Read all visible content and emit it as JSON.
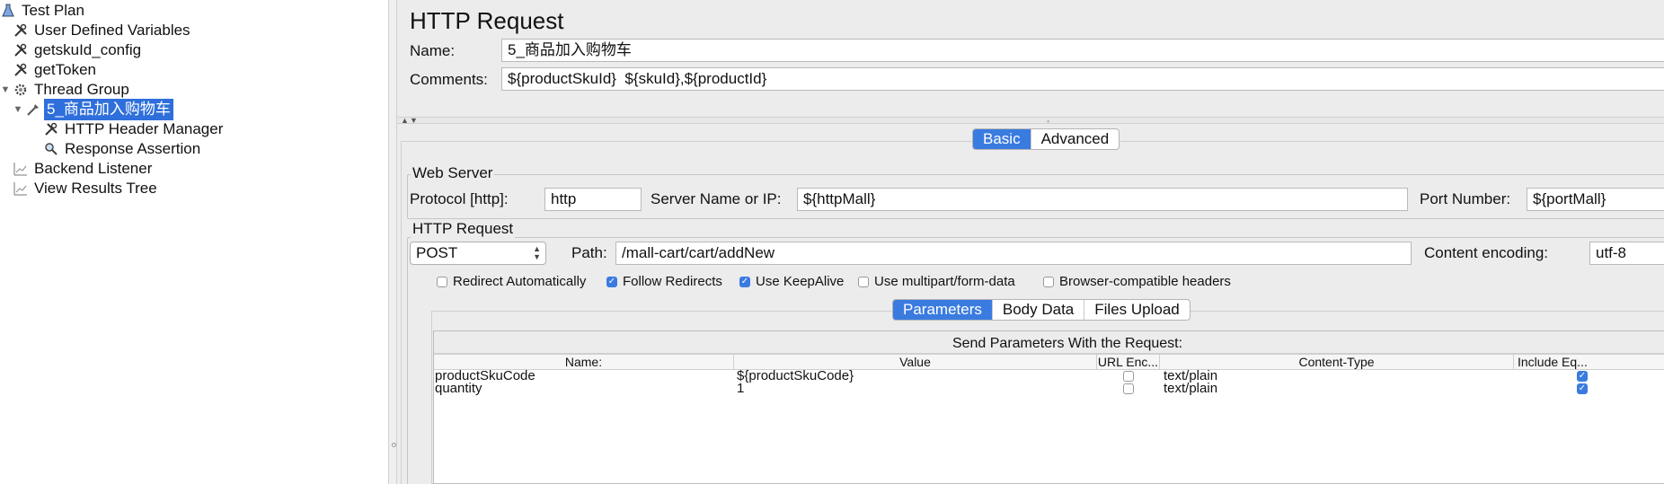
{
  "tree": {
    "items": [
      {
        "label": "Test Plan",
        "icon": "flask-icon"
      },
      {
        "label": "User Defined Variables",
        "icon": "wrench-icon"
      },
      {
        "label": "getskuId_config",
        "icon": "wrench-icon"
      },
      {
        "label": "getToken",
        "icon": "wrench-icon"
      },
      {
        "label": "Thread Group",
        "icon": "gear-icon"
      },
      {
        "label": "5_商品加入购物车",
        "icon": "pipette-icon"
      },
      {
        "label": "HTTP Header Manager",
        "icon": "wrench-icon"
      },
      {
        "label": "Response Assertion",
        "icon": "magnifier-icon"
      },
      {
        "label": "Backend Listener",
        "icon": "chart-icon"
      },
      {
        "label": "View Results Tree",
        "icon": "chart-icon"
      }
    ]
  },
  "sampler": {
    "title": "HTTP Request",
    "name_label": "Name:",
    "name_value": "5_商品加入购物车",
    "comments_label": "Comments:",
    "comments_value": "${productSkuId}  ${skuId},${productId}",
    "tabs": {
      "basic": "Basic",
      "advanced": "Advanced"
    }
  },
  "web_server": {
    "group_title": "Web Server",
    "protocol_label": "Protocol [http]:",
    "protocol_value": "http",
    "server_label": "Server Name or IP:",
    "server_value": "${httpMall}",
    "port_label": "Port Number:",
    "port_value": "${portMall}"
  },
  "http_request": {
    "group_title": "HTTP Request",
    "method": "POST",
    "path_label": "Path:",
    "path_value": "/mall-cart/cart/addNew",
    "encoding_label": "Content encoding:",
    "encoding_value": "utf-8",
    "options": [
      {
        "label": "Redirect Automatically",
        "checked": false
      },
      {
        "label": "Follow Redirects",
        "checked": true
      },
      {
        "label": "Use KeepAlive",
        "checked": true
      },
      {
        "label": "Use multipart/form-data",
        "checked": false
      },
      {
        "label": "Browser-compatible headers",
        "checked": false
      }
    ]
  },
  "params": {
    "tabs": {
      "parameters": "Parameters",
      "body": "Body Data",
      "files": "Files Upload"
    },
    "heading": "Send Parameters With the Request:",
    "columns": {
      "name": "Name:",
      "value": "Value",
      "url_enc": "URL Enc...",
      "content_type": "Content-Type",
      "include_eq": "Include Eq..."
    },
    "rows": [
      {
        "name": "productSkuCode",
        "value": "${productSkuCode}",
        "url_enc": false,
        "content_type": "text/plain",
        "include_eq": true
      },
      {
        "name": "quantity",
        "value": "1",
        "url_enc": false,
        "content_type": "text/plain",
        "include_eq": true
      }
    ]
  },
  "colors": {
    "selection": "#2f6fdb",
    "accent": "#3a7be0",
    "panel_bg": "#ececec"
  }
}
